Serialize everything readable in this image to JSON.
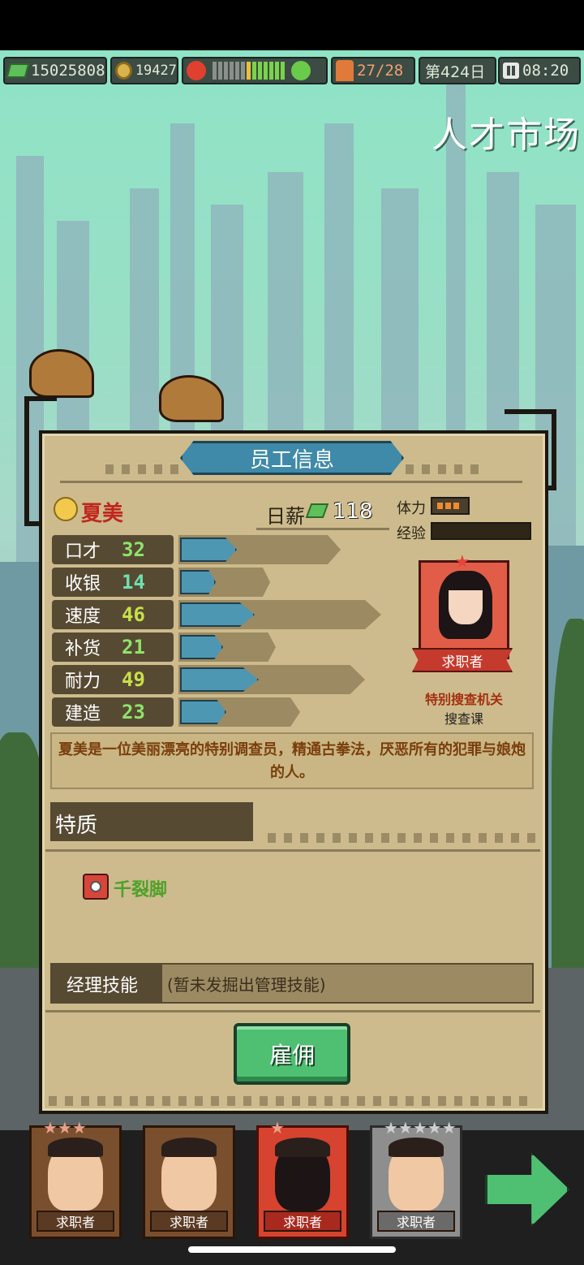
{
  "hud": {
    "money": "15025808",
    "coins": "19427",
    "staff": "27/28",
    "day": "第424日",
    "time": "08:20",
    "mood_meter": [
      {
        "color": "#8b908c"
      },
      {
        "color": "#8b908c"
      },
      {
        "color": "#8b908c"
      },
      {
        "color": "#8b908c"
      },
      {
        "color": "#8b908c"
      },
      {
        "color": "#8b908c"
      },
      {
        "color": "#e8c13a"
      },
      {
        "color": "#7ad34a"
      },
      {
        "color": "#7ad34a"
      },
      {
        "color": "#7ad34a"
      },
      {
        "color": "#7ad34a"
      },
      {
        "color": "#7ad34a"
      },
      {
        "color": "#7ad34a"
      }
    ],
    "icons": {
      "money": "cash-icon",
      "coin": "coin-icon",
      "angry": "angry-face-icon",
      "happy": "happy-face-icon",
      "staff": "staff-icon",
      "pause": "pause-icon"
    }
  },
  "page_title": "人才市场",
  "panel": {
    "title": "员工信息",
    "employee": {
      "name": "夏美",
      "salary_label": "日薪",
      "salary": "118",
      "stamina_label": "体力",
      "exp_label": "经验",
      "stamina_fraction": 0.75,
      "exp_fraction": 0.0,
      "status_label": "求职者",
      "org_line1": "特别搜查机关",
      "org_line2": "搜查课",
      "description": "夏美是一位美丽漂亮的特别调查员，精通古拳法，厌恶所有的犯罪与娘炮的人。"
    },
    "stats": [
      {
        "name": "口才",
        "value": "32",
        "fill": 0.32,
        "max": 0.8,
        "color": "#8fe36a"
      },
      {
        "name": "收银",
        "value": "14",
        "fill": 0.2,
        "max": 0.45,
        "color": "#6de0b0"
      },
      {
        "name": "速度",
        "value": "46",
        "fill": 0.42,
        "max": 1.0,
        "color": "#c8e04a"
      },
      {
        "name": "补货",
        "value": "21",
        "fill": 0.24,
        "max": 0.48,
        "color": "#8fe36a"
      },
      {
        "name": "耐力",
        "value": "49",
        "fill": 0.44,
        "max": 0.92,
        "color": "#c8e04a"
      },
      {
        "name": "建造",
        "value": "23",
        "fill": 0.26,
        "max": 0.6,
        "color": "#8fe36a"
      }
    ],
    "traits_title": "特质",
    "traits": [
      {
        "name": "千裂脚",
        "icon": "trait-fist-icon"
      }
    ],
    "manager_label": "经理技能",
    "manager_value": "(暂未发掘出管理技能)",
    "hire_label": "雇佣"
  },
  "candidates": [
    {
      "label": "求职者",
      "stars": "★★★",
      "style": "normal"
    },
    {
      "label": "求职者",
      "stars": "",
      "style": "normal"
    },
    {
      "label": "求职者",
      "stars": "★",
      "style": "selected"
    },
    {
      "label": "求职者",
      "stars": "★★★★★",
      "style": "gray"
    }
  ]
}
